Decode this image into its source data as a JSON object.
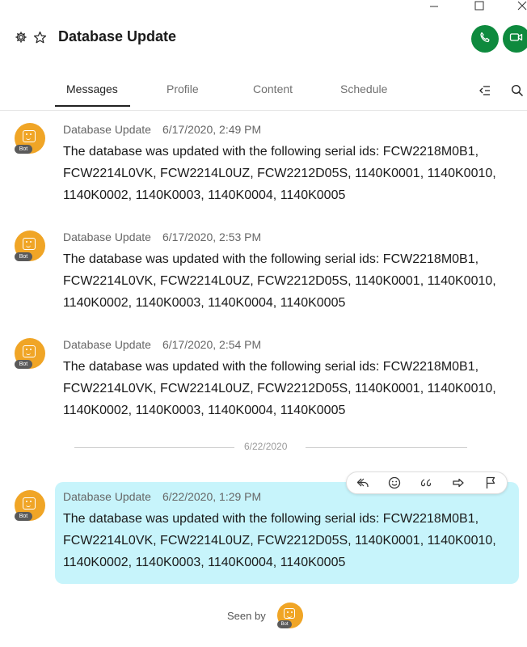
{
  "window": {
    "minimize": "minimize",
    "maximize": "maximize",
    "close": "close"
  },
  "header": {
    "title": "Database Update",
    "icons": [
      "gear-icon",
      "star-icon"
    ],
    "call_icons": [
      "phone-icon",
      "video-icon"
    ],
    "accent": "#0e8a3e"
  },
  "tabs": [
    "Messages",
    "Profile",
    "Content",
    "Schedule"
  ],
  "active_tab": "Messages",
  "messages": [
    {
      "sender": "Database Update",
      "badge": "Bot",
      "time": "6/17/2020, 2:49 PM",
      "text": "The database was updated with the following serial ids: FCW2218M0B1, FCW2214L0VK, FCW2214L0UZ, FCW2212D05S, 1140K0001, 1140K0010, 1140K0002, 1140K0003, 1140K0004, 1140K0005"
    },
    {
      "sender": "Database Update",
      "badge": "Bot",
      "time": "6/17/2020, 2:53 PM",
      "text": "The database was updated with the following serial ids: FCW2218M0B1, FCW2214L0VK, FCW2214L0UZ, FCW2212D05S, 1140K0001, 1140K0010, 1140K0002, 1140K0003, 1140K0004, 1140K0005"
    },
    {
      "sender": "Database Update",
      "badge": "Bot",
      "time": "6/17/2020, 2:54 PM",
      "text": "The database was updated with the following serial ids: FCW2218M0B1, FCW2214L0VK, FCW2214L0UZ, FCW2212D05S, 1140K0001, 1140K0010, 1140K0002, 1140K0003, 1140K0004, 1140K0005"
    },
    {
      "sender": "Database Update",
      "badge": "Bot",
      "time": "6/22/2020, 1:29 PM",
      "text": "The database was updated with the following serial ids: FCW2218M0B1, FCW2214L0VK, FCW2214L0UZ, FCW2212D05S, 1140K0001, 1140K0010, 1140K0002, 1140K0003, 1140K0004, 1140K0005"
    }
  ],
  "date_divider": "6/22/2020",
  "message_actions": [
    "reply-icon",
    "emoji-icon",
    "quote-icon",
    "forward-icon",
    "flag-icon"
  ],
  "seen_by": {
    "label": "Seen by",
    "badge": "Bot"
  },
  "colors": {
    "highlight": "#c7f4fb",
    "avatar": "#f0a526"
  }
}
